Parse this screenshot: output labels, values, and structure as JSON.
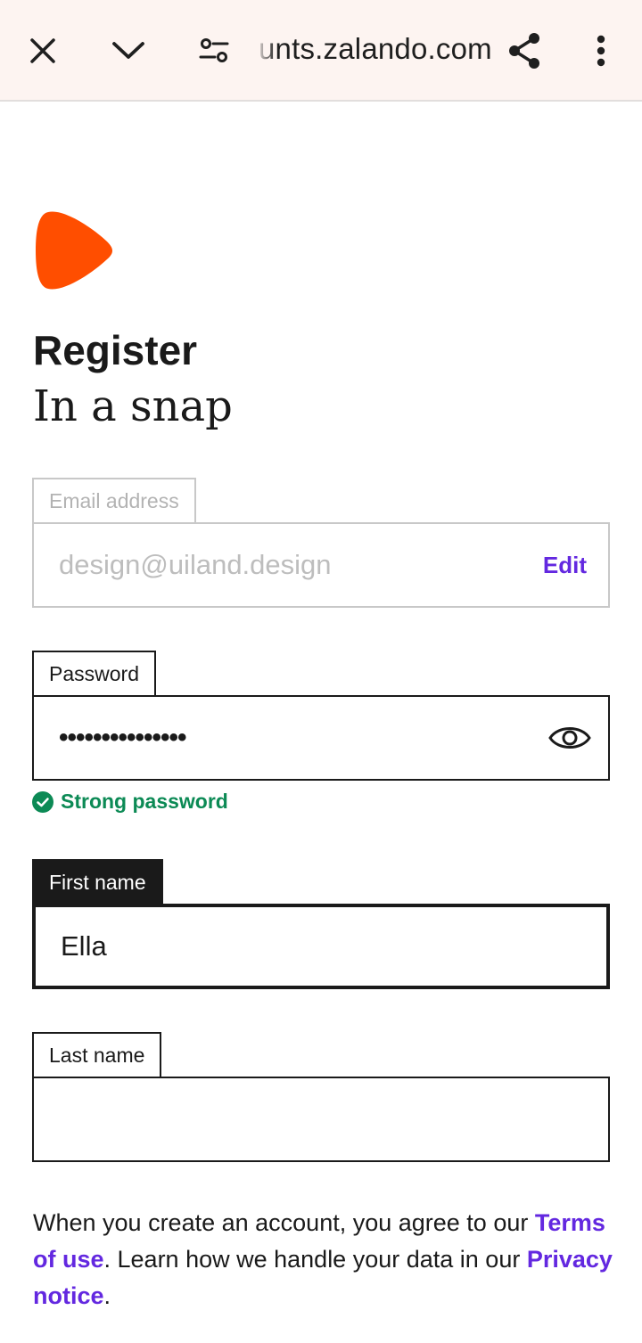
{
  "browser": {
    "url": "unts.zalando.com",
    "icons": {
      "close": "close-icon",
      "collapse": "chevron-down-icon",
      "site_settings": "tune-icon",
      "share": "share-icon",
      "menu": "more-vert-icon"
    }
  },
  "brand": {
    "logo": "zalando-logo",
    "color": "#ff4e00"
  },
  "header": {
    "title": "Register",
    "subtitle": "In a snap"
  },
  "form": {
    "email": {
      "label": "Email address",
      "value": "design@uiland.design",
      "edit_label": "Edit"
    },
    "password": {
      "label": "Password",
      "masked_value": "•••••••••••••••",
      "strength": "Strong password"
    },
    "first_name": {
      "label": "First name",
      "value": "Ella"
    },
    "last_name": {
      "label": "Last name",
      "value": ""
    }
  },
  "legal": {
    "prefix": "When you create an account, you agree to our ",
    "terms_link": "Terms of use",
    "middle": ". Learn how we handle your data in our ",
    "privacy_link": "Privacy notice",
    "suffix": "."
  },
  "colors": {
    "accent": "#6328e0",
    "success": "#0c8a55",
    "topbar_bg": "#fdf4f1"
  }
}
